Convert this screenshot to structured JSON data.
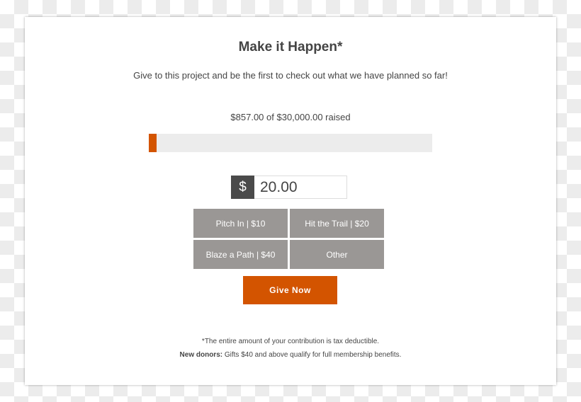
{
  "title": "Make it Happen*",
  "subtitle": "Give to this project and be the first to check out what we have planned so far!",
  "raised_text": "$857.00 of $30,000.00 raised",
  "progress": {
    "raised": 857,
    "goal": 30000,
    "percent": 2.86
  },
  "amount": {
    "currency_symbol": "$",
    "value": "20.00"
  },
  "options": [
    "Pitch In | $10",
    "Hit the Trail | $20",
    "Blaze a Path | $40",
    "Other"
  ],
  "give_button": "Give Now",
  "footnote": "*The entire amount of your contribution is tax deductible.",
  "new_donors_label": "New donors:",
  "new_donors_text": " Gifts $40 and above qualify for full membership benefits.",
  "colors": {
    "accent": "#d35400",
    "option_bg": "#9a9795",
    "currency_bg": "#4a4a4a",
    "bar_bg": "#ececec"
  }
}
